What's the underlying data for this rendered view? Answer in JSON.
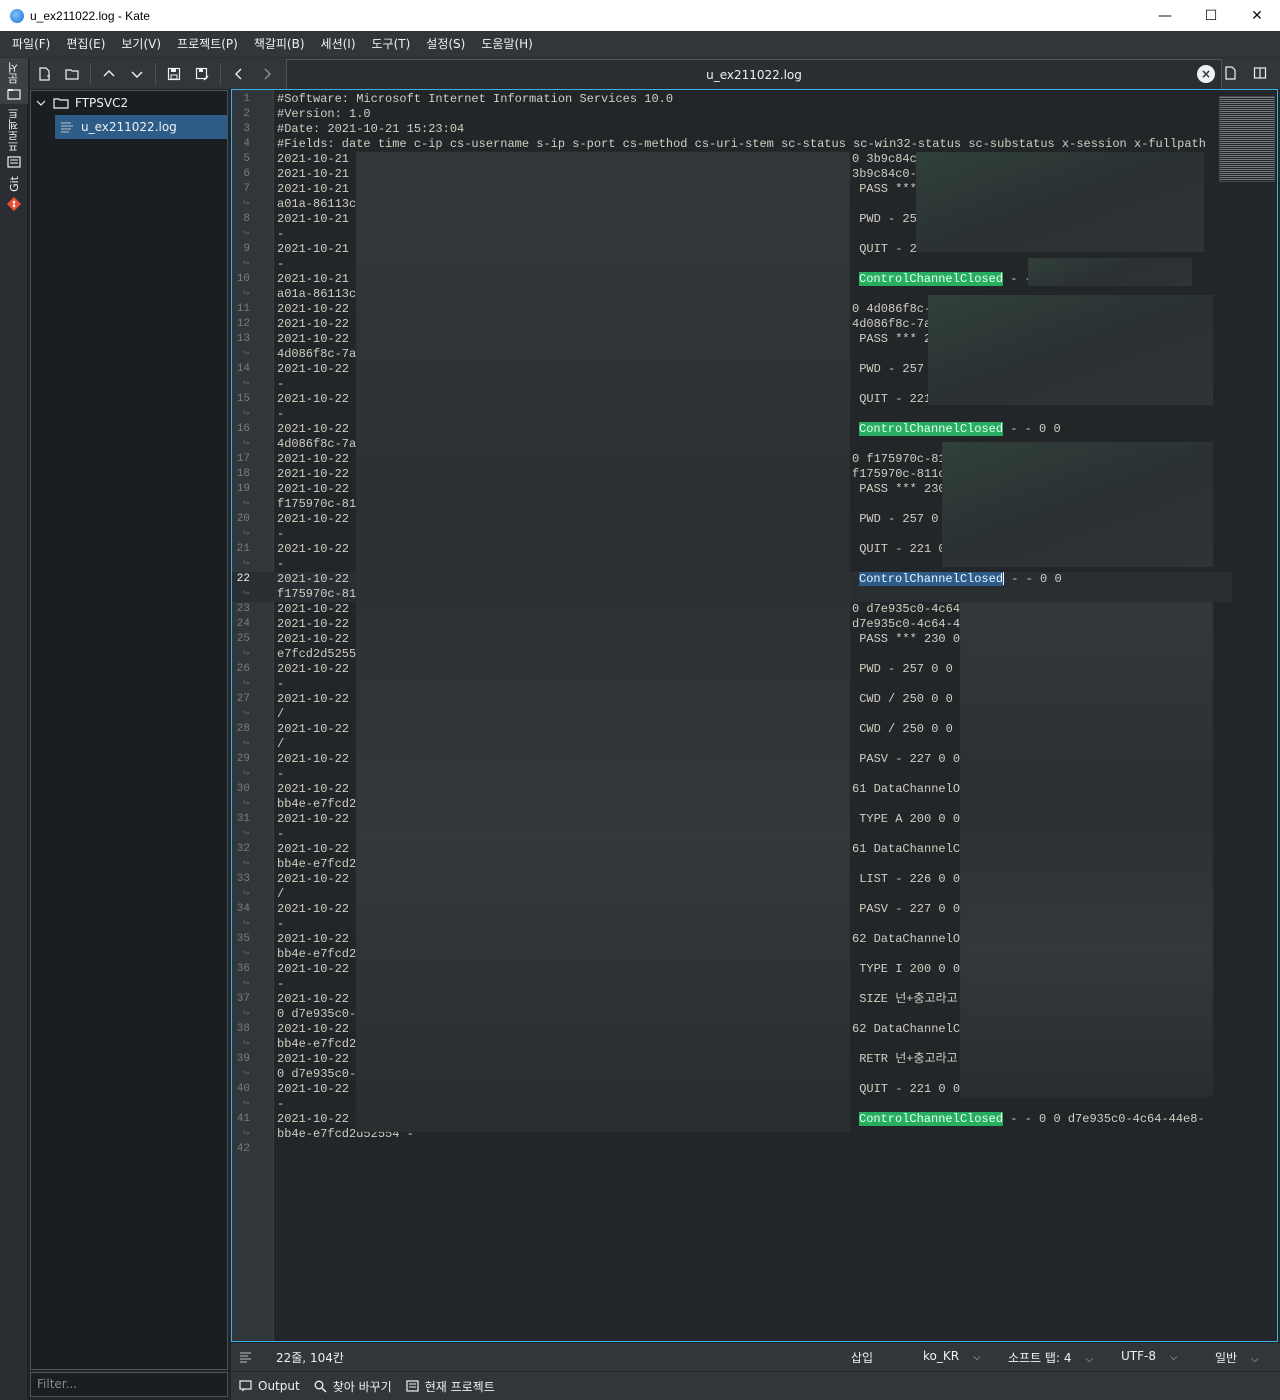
{
  "window": {
    "title": "u_ex211022.log  - Kate",
    "minimize": "—",
    "maximize": "☐",
    "close": "✕"
  },
  "menu": [
    "파일(F)",
    "편집(E)",
    "보기(V)",
    "프로젝트(P)",
    "책갈피(B)",
    "세션(I)",
    "도구(T)",
    "설정(S)",
    "도움말(H)"
  ],
  "side_tabs": {
    "documents": "문서",
    "projects": "프로젝트",
    "git": "Git"
  },
  "tab": {
    "label": "u_ex211022.log"
  },
  "tree": {
    "folder": "FTPSVC2",
    "file": "u_ex211022.log",
    "filter_placeholder": "Filter..."
  },
  "editor": {
    "header_lines": [
      "#Software: Microsoft Internet Information Services 10.0",
      "#Version: 1.0",
      "#Date: 2021-10-21 15:23:04",
      "#Fields: date time c-ip cs-username s-ip s-port cs-method cs-uri-stem sc-status sc-win32-status sc-substatus x-session x-fullpath"
    ],
    "rows": [
      {
        "n": "5",
        "left": "2021-10-21 ",
        "right": "0 3b9c84c0",
        "cont": null
      },
      {
        "n": "6",
        "left": "2021-10-21 ",
        "right": "3b9c84c0-2",
        "cont": null
      },
      {
        "n": "7",
        "left": "2021-10-21 ",
        "right": " PASS ***",
        "cont": "a01a-86113c5"
      },
      {
        "n": "8",
        "left": "2021-10-21 ",
        "right": " PWD - 257",
        "cont": "-"
      },
      {
        "n": "9",
        "left": "2021-10-21 ",
        "right": " QUIT - 22",
        "cont": "-"
      },
      {
        "n": "10",
        "left": "2021-10-21 ",
        "right": "",
        "hl": "ControlChannelClosed",
        "after": " - -",
        "cont": "a01a-86113c5"
      },
      {
        "n": "11",
        "left": "2021-10-22 ",
        "right": "0 4d086f8c-",
        "cont": null
      },
      {
        "n": "12",
        "left": "2021-10-22 ",
        "right": "4d086f8c-7a",
        "cont": null
      },
      {
        "n": "13",
        "left": "2021-10-22 ",
        "right": " PASS *** 2",
        "cont": "4d086f8c-7al"
      },
      {
        "n": "14",
        "left": "2021-10-22 ",
        "right": " PWD - 257",
        "cont": "-"
      },
      {
        "n": "15",
        "left": "2021-10-22 ",
        "right": " QUIT - 221",
        "cont": "-"
      },
      {
        "n": "16",
        "left": "2021-10-22 ",
        "right": "",
        "hl": "ControlChannelClosed",
        "after": " - - 0 0",
        "cont": "4d086f8c-7al"
      },
      {
        "n": "17",
        "left": "2021-10-22 ",
        "right": "0 f175970c-81",
        "cont": null
      },
      {
        "n": "18",
        "left": "2021-10-22 ",
        "right": "f175970c-811c",
        "cont": null
      },
      {
        "n": "19",
        "left": "2021-10-22 ",
        "right": " PASS *** 230",
        "cont": "f175970c-81"
      },
      {
        "n": "20",
        "left": "2021-10-22 ",
        "right": " PWD - 257 0",
        "cont": "-"
      },
      {
        "n": "21",
        "left": "2021-10-22 ",
        "right": " QUIT - 221 0",
        "cont": "-"
      },
      {
        "n": "22",
        "left": "2021-10-22 ",
        "right": "",
        "hlsel": "ControlChannelClosed",
        "after": " - - 0 0",
        "cont": "f175970c-81",
        "current": true
      },
      {
        "n": "23",
        "left": "2021-10-22 ",
        "right": "0 d7e935c0-4c64-",
        "cont": null
      },
      {
        "n": "24",
        "left": "2021-10-22 ",
        "right": "d7e935c0-4c64-4",
        "cont": null
      },
      {
        "n": "25",
        "left": "2021-10-22 ",
        "right": " PASS *** 230 0",
        "cont": "e7fcd2d5255"
      },
      {
        "n": "26",
        "left": "2021-10-22 ",
        "right": " PWD - 257 0 0 c",
        "cont": "-"
      },
      {
        "n": "27",
        "left": "2021-10-22 ",
        "right": " CWD / 250 0 0 c",
        "cont": "/"
      },
      {
        "n": "28",
        "left": "2021-10-22 ",
        "right": " CWD / 250 0 0 c",
        "cont": "/"
      },
      {
        "n": "29",
        "left": "2021-10-22 ",
        "right": " PASV - 227 0 0",
        "cont": "-"
      },
      {
        "n": "30",
        "left": "2021-10-22 ",
        "right": "61 DataChannelOp",
        "cont": "bb4e-e7fcd2c"
      },
      {
        "n": "31",
        "left": "2021-10-22 ",
        "right": " TYPE A 200 0 0",
        "cont": "-"
      },
      {
        "n": "32",
        "left": "2021-10-22 ",
        "right": "61 DataChannelCl",
        "cont": "bb4e-e7fcd2c"
      },
      {
        "n": "33",
        "left": "2021-10-22 ",
        "right": " LIST - 226 0 0",
        "cont": "/"
      },
      {
        "n": "34",
        "left": "2021-10-22 ",
        "right": " PASV - 227 0 0",
        "cont": "-"
      },
      {
        "n": "35",
        "left": "2021-10-22 ",
        "right": "62 DataChannelOp",
        "cont": "bb4e-e7fcd2c"
      },
      {
        "n": "36",
        "left": "2021-10-22 ",
        "right": " TYPE I 200 0 0",
        "cont": "-"
      },
      {
        "n": "37",
        "left": "2021-10-22 ",
        "right": " SIZE 넌+충고라고",
        "cont": "0 d7e935c0-4"
      },
      {
        "n": "38",
        "left": "2021-10-22 ",
        "right": "62 DataChannelCl",
        "cont": "bb4e-e7fcd2c"
      },
      {
        "n": "39",
        "left": "2021-10-22 ",
        "right": " RETR 넌+충고라고",
        "cont": "0 d7e935c0-4"
      },
      {
        "n": "40",
        "left": "2021-10-22 ",
        "right": " QUIT - 221 0 0",
        "cont": "-"
      },
      {
        "n": "41",
        "left": "2021-10-22 ",
        "right": "",
        "hl": "ControlChannelClosed",
        "after": " - - 0 0 d7e935c0-4c64-44e8-",
        "cont": "bb4e-e7fcd2d52554 -"
      },
      {
        "n": "42",
        "left": "",
        "right": "",
        "cont": null
      }
    ]
  },
  "status": {
    "position": "22줄, 104칸",
    "mode": "삽입",
    "language": "ko_KR",
    "indent": "소프트 탭: 4",
    "encoding": "UTF-8",
    "filetype": "일반"
  },
  "bottom": {
    "output": "Output",
    "search": "찾아 바꾸기",
    "project": "현재 프로젝트"
  },
  "colors": {
    "accent": "#3daee9",
    "highlight_green": "#27ae60",
    "selection": "#2d5c88"
  }
}
